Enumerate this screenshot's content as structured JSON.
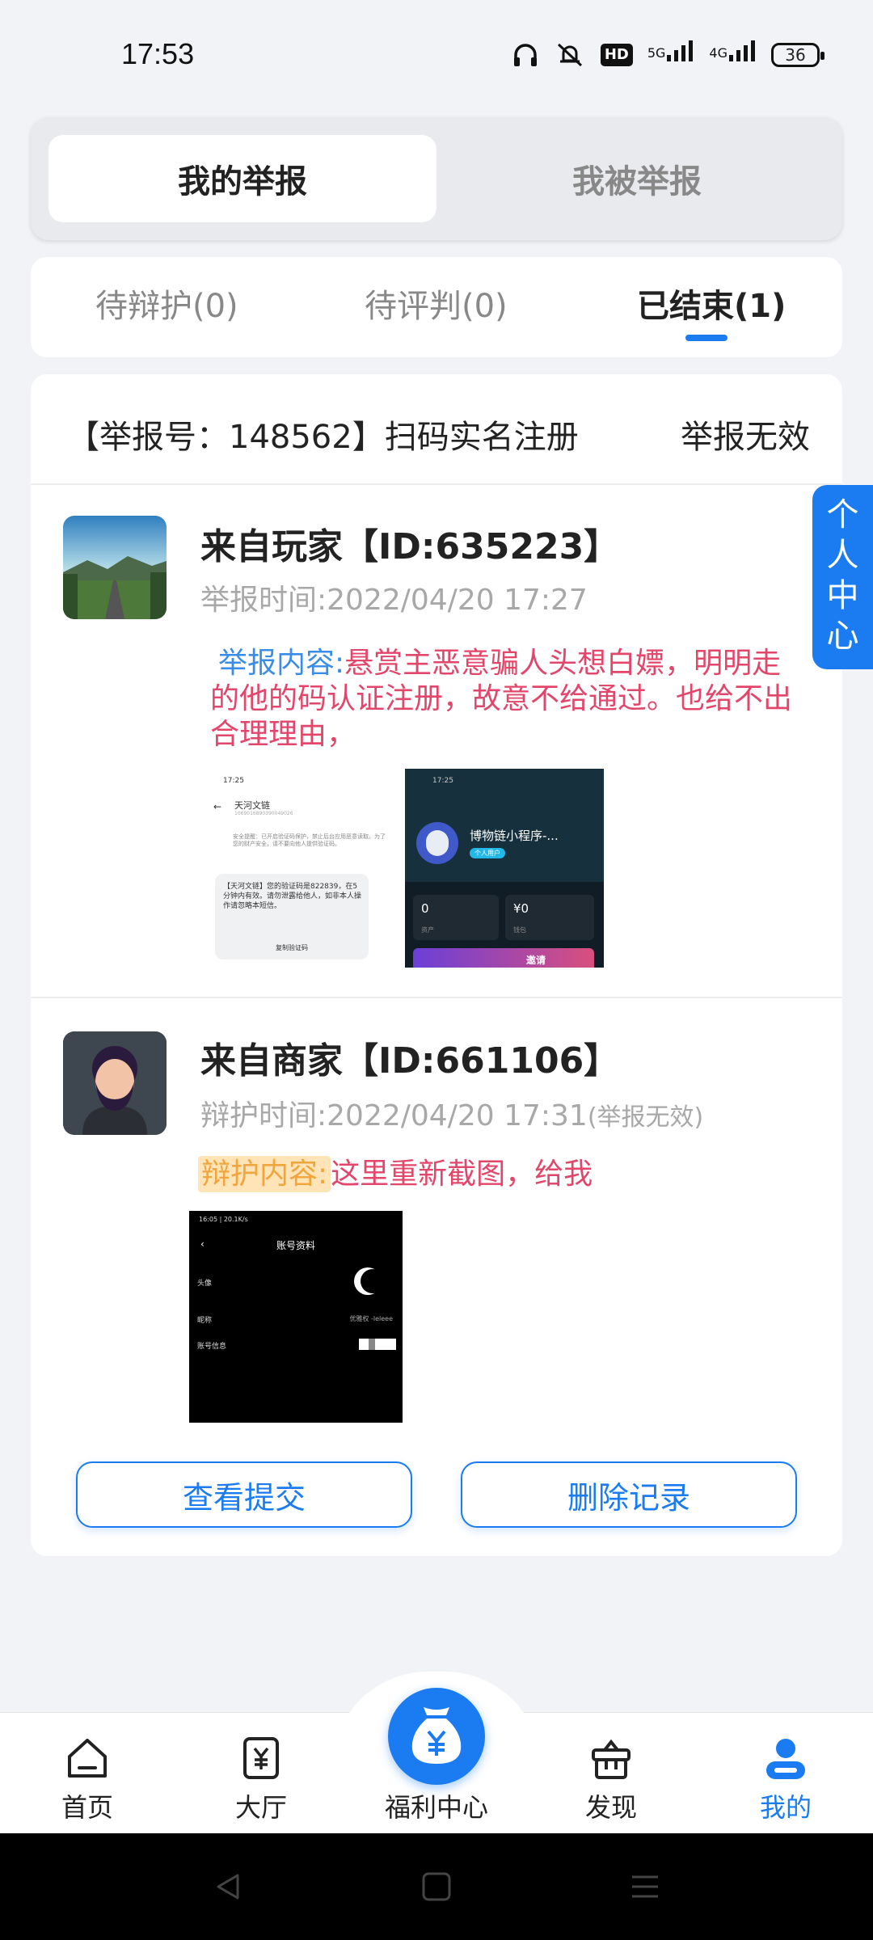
{
  "status_bar": {
    "time": "17:53",
    "hd_badge": "HD",
    "net_5g": "5G",
    "net_4g": "4G",
    "battery": "36"
  },
  "top_tabs": {
    "my_reports": "我的举报",
    "reported_me": "我被举报"
  },
  "sub_tabs": {
    "pending_defense": "待辩护(0)",
    "pending_judgment": "待评判(0)",
    "finished": "已结束(1)"
  },
  "report": {
    "header": "【举报号：148562】扫码实名注册",
    "status": "举报无效",
    "reporter": {
      "name": "来自玩家【ID:635223】",
      "time": "举报时间:2022/04/20 17:27",
      "content_label": "举报内容:",
      "content_text": "悬赏主恶意骗人头想白嫖，明明走的他的码认证注册，故意不给通过。也给不出合理理由，",
      "shot1": {
        "time": "17:25",
        "contact": "天河文链",
        "contact_sub": "1069016890390049026",
        "safety_tip": "安全提醒：已开启验证码保护，禁止后台应用恶意读取。为了您的财产安全，请不要向他人提供验证码。",
        "sms": "【天河文链】您的验证码是822839，在5分钟内有效。请勿泄露给他人，如非本人操作请忽略本短信。",
        "copy_code": "复制验证码"
      },
      "shot2": {
        "time": "17:25",
        "title": "博物链小程序-...",
        "badge": "个人用户",
        "asset_value": "0",
        "asset_label": "资产",
        "wallet_value": "¥0",
        "wallet_label": "钱包",
        "invite": "邀请"
      }
    },
    "merchant": {
      "name": "来自商家【ID:661106】",
      "time": "辩护时间:2022/04/20 17:31",
      "time_suffix": "(举报无效)",
      "content_label": "辩护内容:",
      "content_text": "这里重新截图，给我",
      "shot3": {
        "status": "16:05 | 20.1K/s",
        "title": "账号资料",
        "row_avatar": "头像",
        "row_nick": "昵称",
        "row_nick_val": "优雅权 -leleee",
        "row_info": "账号信息"
      }
    },
    "btn_view": "查看提交",
    "btn_delete": "删除记录"
  },
  "side_tab": [
    "个",
    "人",
    "中",
    "心"
  ],
  "bottom_nav": {
    "items": [
      {
        "label": "首页",
        "icon": "home-icon"
      },
      {
        "label": "大厅",
        "icon": "yuan-card-icon"
      },
      {
        "label": "福利中心",
        "icon": "money-bag-icon"
      },
      {
        "label": "发现",
        "icon": "gift-box-icon"
      },
      {
        "label": "我的",
        "icon": "user-icon"
      }
    ]
  },
  "colors": {
    "accent": "#1a7cf0",
    "content_red": "#e2466a",
    "label_blue": "#3a8de6",
    "label_orange": "#f0a53d"
  }
}
